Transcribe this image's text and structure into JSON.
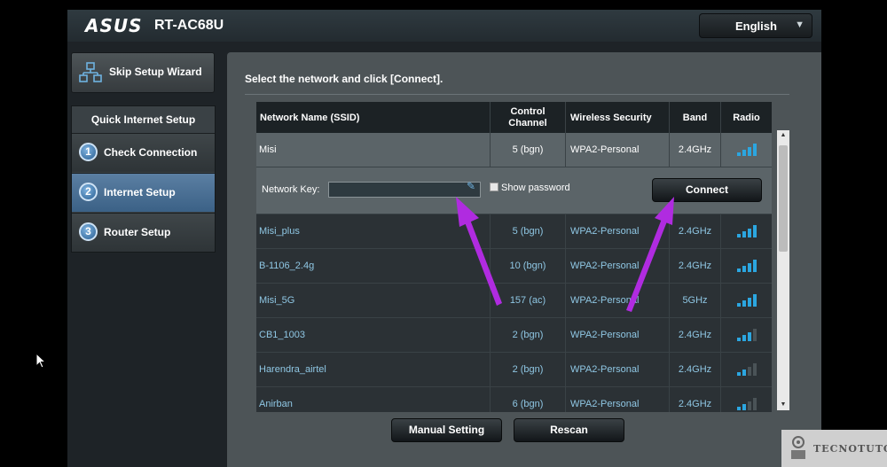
{
  "header": {
    "logo": "ASUS",
    "model": "RT-AC68U",
    "language": "English"
  },
  "sidebar": {
    "skip_label": "Skip Setup Wizard",
    "steps_title": "Quick Internet Setup",
    "steps": [
      {
        "num": "1",
        "label": "Check Connection",
        "active": false
      },
      {
        "num": "2",
        "label": "Internet Setup",
        "active": true
      },
      {
        "num": "3",
        "label": "Router Setup",
        "active": false
      }
    ]
  },
  "main": {
    "instruction": "Select the network and click [Connect].",
    "columns": [
      "Network Name (SSID)",
      "Control\nChannel",
      "Wireless Security",
      "Band",
      "Radio"
    ],
    "selected": {
      "ssid": "Misi",
      "channel": "5 (bgn)",
      "security": "WPA2-Personal",
      "band": "2.4GHz",
      "signal": 4
    },
    "key": {
      "label": "Network Key:",
      "value": "",
      "show_password_label": "Show password",
      "connect_label": "Connect"
    },
    "networks": [
      {
        "ssid": "Misi_plus",
        "channel": "5 (bgn)",
        "security": "WPA2-Personal",
        "band": "2.4GHz",
        "signal": 4
      },
      {
        "ssid": "B-1106_2.4g",
        "channel": "10 (bgn)",
        "security": "WPA2-Personal",
        "band": "2.4GHz",
        "signal": 4
      },
      {
        "ssid": "Misi_5G",
        "channel": "157 (ac)",
        "security": "WPA2-Personal",
        "band": "5GHz",
        "signal": 4
      },
      {
        "ssid": "CB1_1003",
        "channel": "2 (bgn)",
        "security": "WPA2-Personal",
        "band": "2.4GHz",
        "signal": 3
      },
      {
        "ssid": "Harendra_airtel",
        "channel": "2 (bgn)",
        "security": "WPA2-Personal",
        "band": "2.4GHz",
        "signal": 2
      },
      {
        "ssid": "Anirban",
        "channel": "6 (bgn)",
        "security": "WPA2-Personal",
        "band": "2.4GHz",
        "signal": 2
      }
    ],
    "manual_label": "Manual Setting",
    "rescan_label": "Rescan"
  },
  "watermark": {
    "text": "TECNOTUTO"
  },
  "colors": {
    "accent": "#2ba6e0",
    "arrow": "#b02be0",
    "active_step": "#4a7099"
  }
}
